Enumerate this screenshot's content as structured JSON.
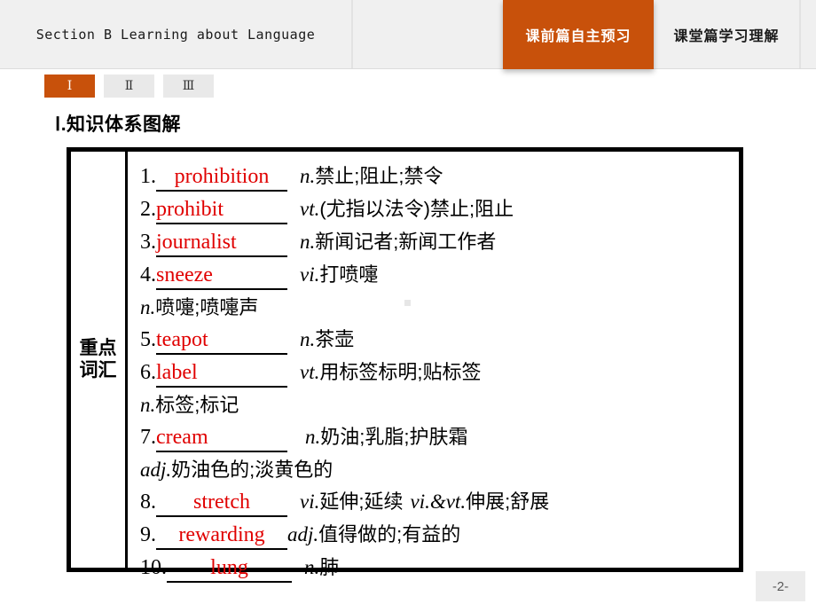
{
  "header": {
    "title": "Section B  Learning about Language",
    "tabs": [
      {
        "label": "课前篇自主预习",
        "active": true
      },
      {
        "label": "课堂篇学习理解",
        "active": false
      }
    ],
    "active_color": "#c8510b"
  },
  "subtabs": [
    {
      "label": "Ⅰ",
      "active": true
    },
    {
      "label": "Ⅱ",
      "active": false
    },
    {
      "label": "Ⅲ",
      "active": false
    }
  ],
  "section": {
    "heading": "Ⅰ.知识体系图解"
  },
  "content_box": {
    "label": "重点词汇",
    "entries": [
      {
        "num": "1.",
        "word": "prohibition",
        "pos": "n.",
        "def": " 禁止;阻止;禁令",
        "cont": null
      },
      {
        "num": "2.",
        "word": "prohibit",
        "pos": "vt.",
        "def": "(尤指以法令)禁止;阻止",
        "cont": null
      },
      {
        "num": "3.",
        "word": "journalist",
        "pos": "n.",
        "def": "新闻记者;新闻工作者",
        "cont": null
      },
      {
        "num": "4.",
        "word": "sneeze",
        "pos": "vi.",
        "def": "打喷嚏",
        "cont": {
          "pos": "n.",
          "def": "喷嚏;喷嚏声"
        }
      },
      {
        "num": "5.",
        "word": "teapot",
        "pos": "n.",
        "def": "茶壶",
        "cont": null
      },
      {
        "num": "6.",
        "word": "label",
        "pos": "vt.",
        "def": "用标签标明;贴标签",
        "cont": {
          "pos": "n.",
          "def": "标签;标记"
        }
      },
      {
        "num": "7.",
        "word": "cream",
        "pos": "n.",
        "def": "奶油;乳脂;护肤霜",
        "cont": {
          "pos": "adj.",
          "def": "奶油色的;淡黄色的"
        }
      },
      {
        "num": "8.",
        "word": "stretch",
        "pos": "vi.",
        "def": "延伸;延续",
        "pos2": "vi.&vt.",
        "def2": "伸展;舒展",
        "cont": null
      },
      {
        "num": "9.",
        "word": "rewarding",
        "pos": "adj.",
        "def": "值得做的;有益的",
        "cont": null
      },
      {
        "num": "10.",
        "word": "lung",
        "pos": "n.",
        "def": "肺",
        "cont": null
      }
    ]
  },
  "footer": {
    "page_number": "-2-"
  }
}
